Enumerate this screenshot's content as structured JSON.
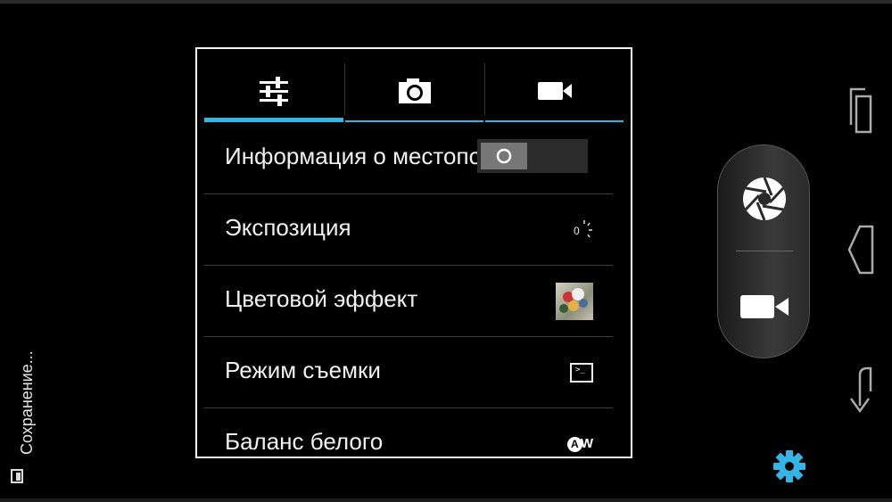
{
  "status": {
    "saving_text": "Сохранение..."
  },
  "settings_tabs": [
    {
      "icon": "sliders-icon",
      "active": true
    },
    {
      "icon": "camera-icon",
      "active": false
    },
    {
      "icon": "video-camera-icon",
      "active": false
    }
  ],
  "settings_rows": {
    "location": {
      "label": "Информация о местоположении",
      "toggle_glyph": "O"
    },
    "exposure": {
      "label": "Экспозиция",
      "value": "0"
    },
    "color_effect": {
      "label": "Цветовой эффект"
    },
    "scene_mode": {
      "label": "Режим съемки",
      "icon_text": ">_"
    },
    "white_balance": {
      "label": "Баланс белого",
      "icon_letters": "A",
      "icon_suffix": "W"
    }
  },
  "colors": {
    "accent": "#33b5e5",
    "panel_border": "#f2f2f2",
    "background": "#000000"
  }
}
